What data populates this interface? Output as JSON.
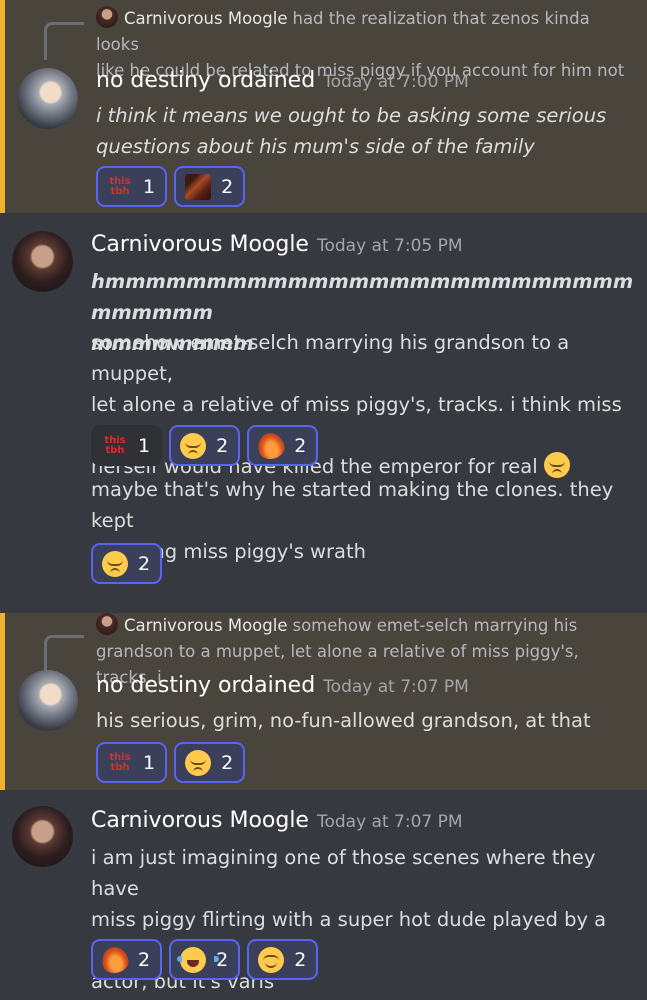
{
  "messages": [
    {
      "reply": {
        "author": "Carnivorous Moogle",
        "text_line1": "had the realization that zenos kinda looks",
        "text_line2": "like he could be related to miss piggy if you account for him not"
      },
      "author": "no destiny ordained",
      "timestamp": "Today at 7:00 PM",
      "lines": [
        "i think it means we ought to be asking some serious",
        "questions about his mum's side of the family"
      ],
      "reactions": [
        {
          "emoji": "this-tbh-emoji",
          "label": "this tbh",
          "count": "1"
        },
        {
          "emoji": "custom-image-emoji",
          "count": "2"
        }
      ]
    },
    {
      "author": "Carnivorous Moogle",
      "timestamp": "Today at 7:05 PM",
      "bold_lines": [
        "hmmmmmmmmmmmmmmmmmmmmmmmmmmmmmmmm",
        "mmmmmmmm"
      ],
      "lines": [
        "somehow emet-selch marrying his grandson to a muppet,",
        "let alone a relative of miss piggy's, tracks. i think miss piggy",
        "herself would have killed the emperor for real"
      ],
      "inline_emoji": "pensive-emoji",
      "reactions": [
        {
          "emoji": "this-tbh-emoji",
          "label": "this tbh",
          "count": "1",
          "active": false
        },
        {
          "emoji": "pensive-emoji",
          "count": "2"
        },
        {
          "emoji": "fire-emoji",
          "count": "2"
        }
      ],
      "followup_lines": [
        "maybe that's why he started making the clones. they kept",
        "suffering miss piggy's wrath"
      ],
      "followup_reactions": [
        {
          "emoji": "pensive-emoji",
          "count": "2"
        }
      ]
    },
    {
      "reply": {
        "author": "Carnivorous Moogle",
        "text_line1": "somehow emet-selch marrying his",
        "text_line2": "grandson to a muppet, let alone a relative of miss piggy's, tracks. i"
      },
      "author": "no destiny ordained",
      "timestamp": "Today at 7:07 PM",
      "lines": [
        "his serious, grim, no-fun-allowed grandson, at that"
      ],
      "reactions": [
        {
          "emoji": "this-tbh-emoji",
          "label": "this tbh",
          "count": "1"
        },
        {
          "emoji": "pensive-emoji",
          "count": "2"
        }
      ]
    },
    {
      "author": "Carnivorous Moogle",
      "timestamp": "Today at 7:07 PM",
      "lines": [
        "i am just imagining one of those scenes where they have",
        "miss piggy flirting with a super hot dude played by a human",
        "actor, but it's varis"
      ],
      "reactions": [
        {
          "emoji": "fire-emoji",
          "count": "2"
        },
        {
          "emoji": "joy-emoji",
          "count": "2"
        },
        {
          "emoji": "relieved-emoji",
          "count": "2"
        }
      ]
    }
  ],
  "colors": {
    "background": "#36393f",
    "mention_background": "#49443c",
    "mention_bar": "#f0b132",
    "reaction_active_border": "#5865f2",
    "username": "#ffffff",
    "timestamp": "#a3a6aa"
  }
}
